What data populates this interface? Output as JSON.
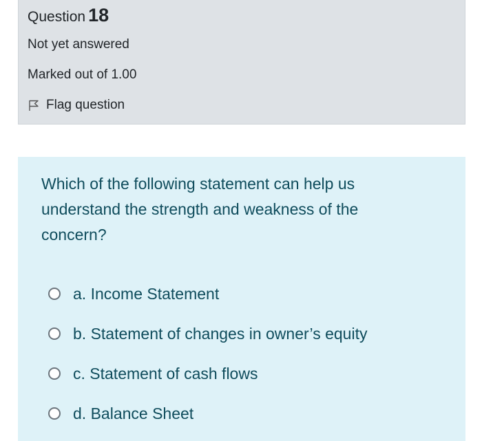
{
  "question": {
    "label": "Question",
    "number": "18",
    "state": "Not yet answered",
    "grade": "Marked out of 1.00",
    "flag_label": "Flag question",
    "flag_icon": "flag-outline-icon"
  },
  "content": {
    "text": "Which of the following statement can help us understand the strength and weakness of the concern?",
    "answers": [
      {
        "label": "a. Income Statement",
        "selected": false
      },
      {
        "label": "b. Statement of changes in owner’s equity",
        "selected": false
      },
      {
        "label": "c. Statement of cash flows",
        "selected": false
      },
      {
        "label": "d. Balance Sheet",
        "selected": false
      }
    ]
  },
  "colors": {
    "info_bg": "#dee2e6",
    "content_bg": "#def2f8",
    "question_text": "#0f4c5c"
  }
}
